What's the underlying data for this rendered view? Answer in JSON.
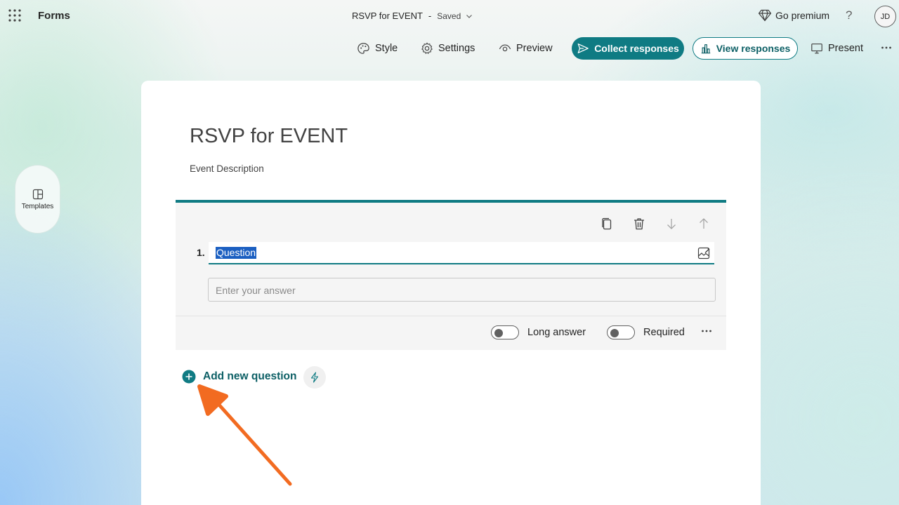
{
  "header": {
    "app_name": "Forms",
    "doc_title": "RSVP for EVENT",
    "doc_separator": "-",
    "doc_status": "Saved",
    "go_premium": "Go premium",
    "help": "?",
    "avatar_initials": "JD"
  },
  "toolbar": {
    "style": "Style",
    "settings": "Settings",
    "preview": "Preview",
    "collect_responses": "Collect responses",
    "view_responses": "View responses",
    "present": "Present"
  },
  "left_rail": {
    "templates": "Templates"
  },
  "form": {
    "title": "RSVP for EVENT",
    "description": "Event Description",
    "question": {
      "number": "1.",
      "text": "Question",
      "answer_placeholder": "Enter your answer",
      "long_answer_label": "Long answer",
      "required_label": "Required"
    },
    "add_question": "Add new question"
  },
  "colors": {
    "accent": "#0f7b83",
    "accent_text": "#0c5f65",
    "annotation_arrow": "#f26b21",
    "selection": "#1b5fc1"
  }
}
